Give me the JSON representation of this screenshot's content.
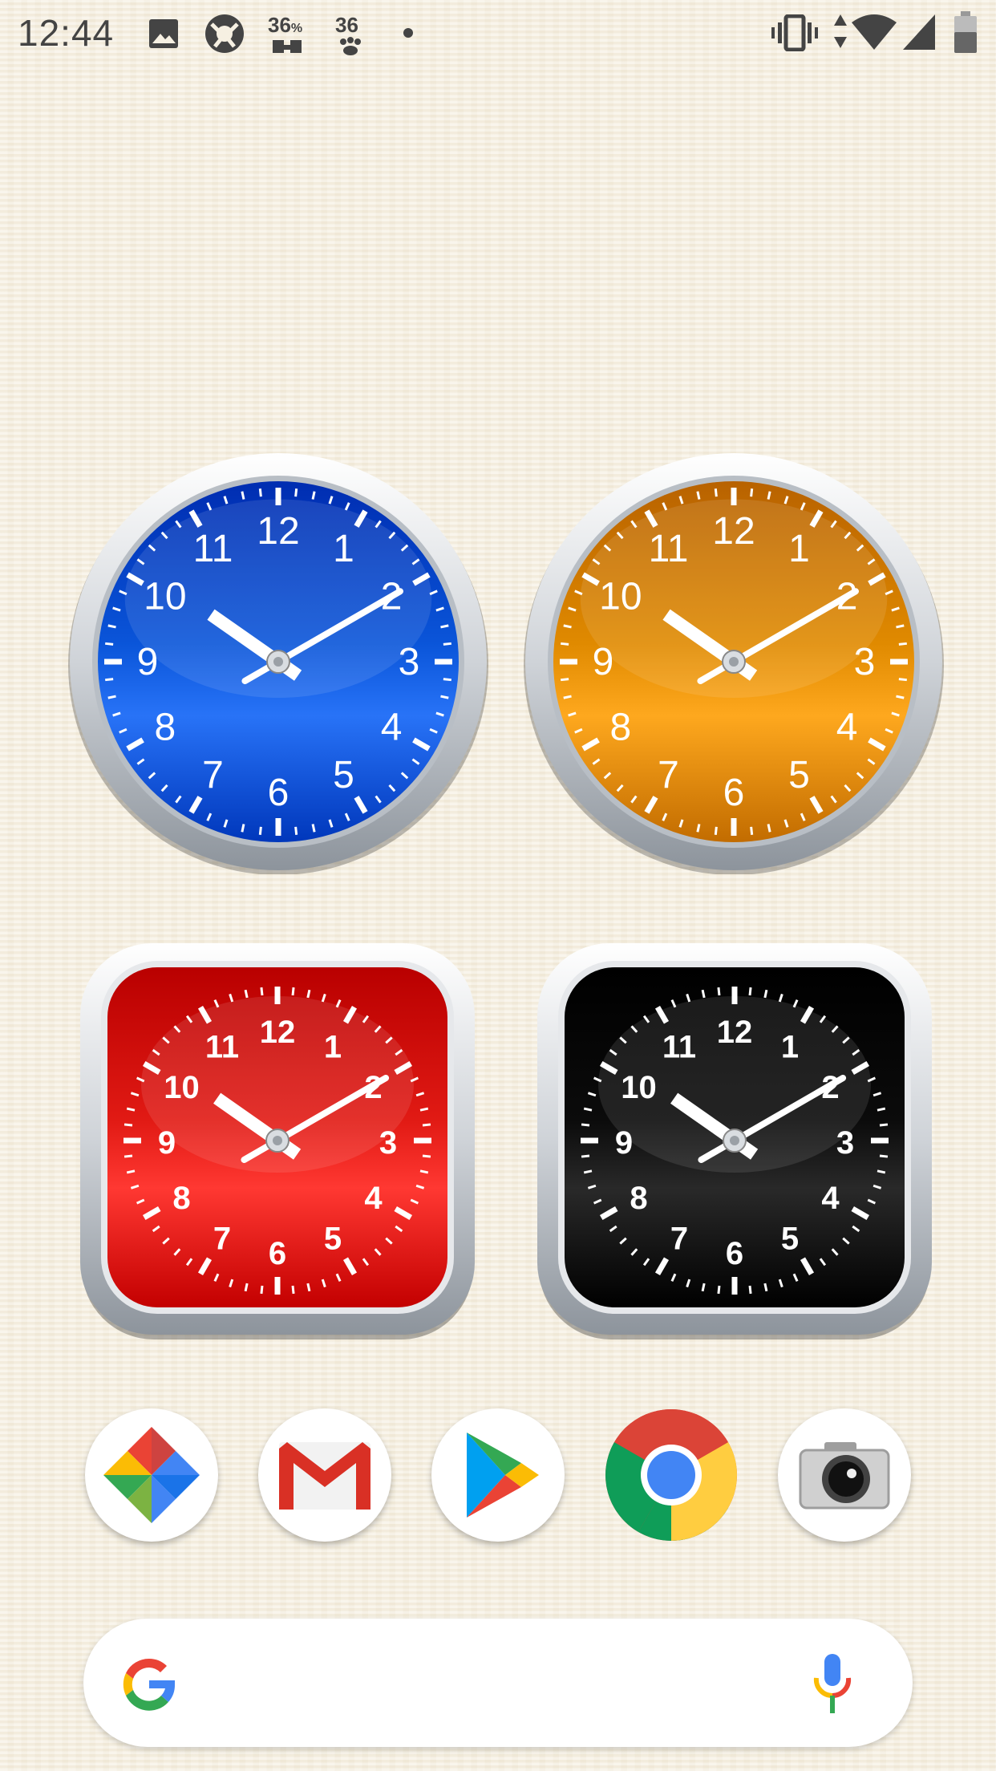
{
  "status_bar": {
    "time": "12:44",
    "notification_icons": [
      "image-icon",
      "app-notification-icon",
      "weather-icon",
      "paw-icon",
      "more-dot-icon"
    ],
    "notif_temp_1": "36",
    "notif_temp_1_unit": "%",
    "notif_temp_2": "36",
    "system_icons": [
      "vibrate-icon",
      "data-arrows-icon",
      "wifi-icon",
      "cell-signal-icon",
      "battery-icon"
    ]
  },
  "clocks": [
    {
      "name": "blue-round-clock",
      "style": "round",
      "face_color": "#0a55d9",
      "numbers": [
        "12",
        "1",
        "2",
        "3",
        "4",
        "5",
        "6",
        "7",
        "8",
        "9",
        "10",
        "11"
      ]
    },
    {
      "name": "orange-round-clock",
      "style": "round",
      "face_color": "#e08a00",
      "numbers": [
        "12",
        "1",
        "2",
        "3",
        "4",
        "5",
        "6",
        "7",
        "8",
        "9",
        "10",
        "11"
      ]
    },
    {
      "name": "red-square-clock",
      "style": "square",
      "face_color": "#e11a14",
      "numbers": [
        "12",
        "1",
        "2",
        "3",
        "4",
        "5",
        "6",
        "7",
        "8",
        "9",
        "10",
        "11"
      ]
    },
    {
      "name": "black-square-clock",
      "style": "square",
      "face_color": "#0b0b0b",
      "numbers": [
        "12",
        "1",
        "2",
        "3",
        "4",
        "5",
        "6",
        "7",
        "8",
        "9",
        "10",
        "11"
      ]
    }
  ],
  "clock_time": {
    "hour": 10,
    "minute": 10
  },
  "dock": {
    "apps": [
      "photos-icon",
      "gmail-icon",
      "play-store-icon",
      "chrome-icon",
      "camera-icon"
    ]
  },
  "search": {
    "placeholder": "",
    "google_logo": "google-g-icon",
    "mic": "mic-icon"
  },
  "colors": {
    "wallpaper": "#f6f0e2",
    "google_blue": "#4285f4",
    "google_red": "#ea4335",
    "google_yellow": "#fbbc05",
    "google_green": "#34a853"
  }
}
